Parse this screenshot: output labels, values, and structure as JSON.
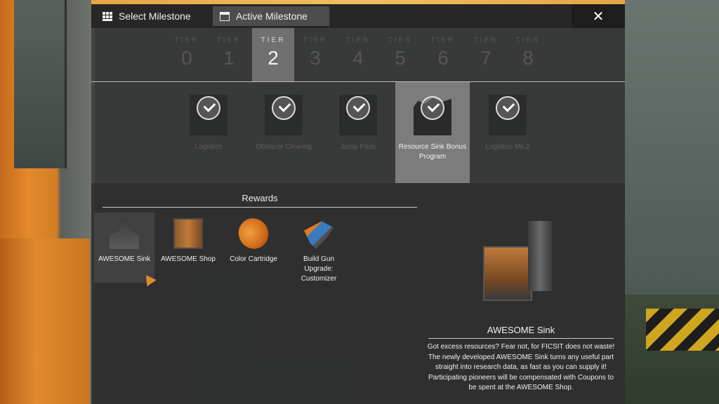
{
  "tabs": [
    {
      "label": "Select Milestone",
      "icon": "grid-icon"
    },
    {
      "label": "Active Milestone",
      "icon": "window-icon"
    }
  ],
  "close_label": "✕",
  "tiers": {
    "label": "TIER",
    "selected": "2",
    "numbers": [
      "0",
      "1",
      "2",
      "3",
      "4",
      "5",
      "6",
      "7",
      "8"
    ]
  },
  "schematics": [
    {
      "name": "Logistics",
      "completed": true
    },
    {
      "name": "Obstacle Clearing",
      "completed": true
    },
    {
      "name": "Jump Pads",
      "completed": true
    },
    {
      "name": "Resource Sink Bonus Program",
      "completed": true,
      "selected": true
    },
    {
      "name": "Logistics Mk.2",
      "completed": true
    }
  ],
  "rewards": {
    "title": "Rewards",
    "items": [
      {
        "name": "AWESOME Sink"
      },
      {
        "name": "AWESOME Shop"
      },
      {
        "name": "Color Cartridge"
      },
      {
        "name": "Build Gun Upgrade: Customizer"
      }
    ]
  },
  "detail": {
    "title": "AWESOME Sink",
    "description": "Got excess resources? Fear not, for FICSIT does not waste! The newly developed AWESOME Sink turns any useful part straight into research data, as fast as you can supply it! Participating pioneers will be compensated with Coupons to be spent at the AWESOME Shop."
  },
  "colors": {
    "accent": "#e08a2a",
    "selected_bg": "#7c7c7c"
  }
}
